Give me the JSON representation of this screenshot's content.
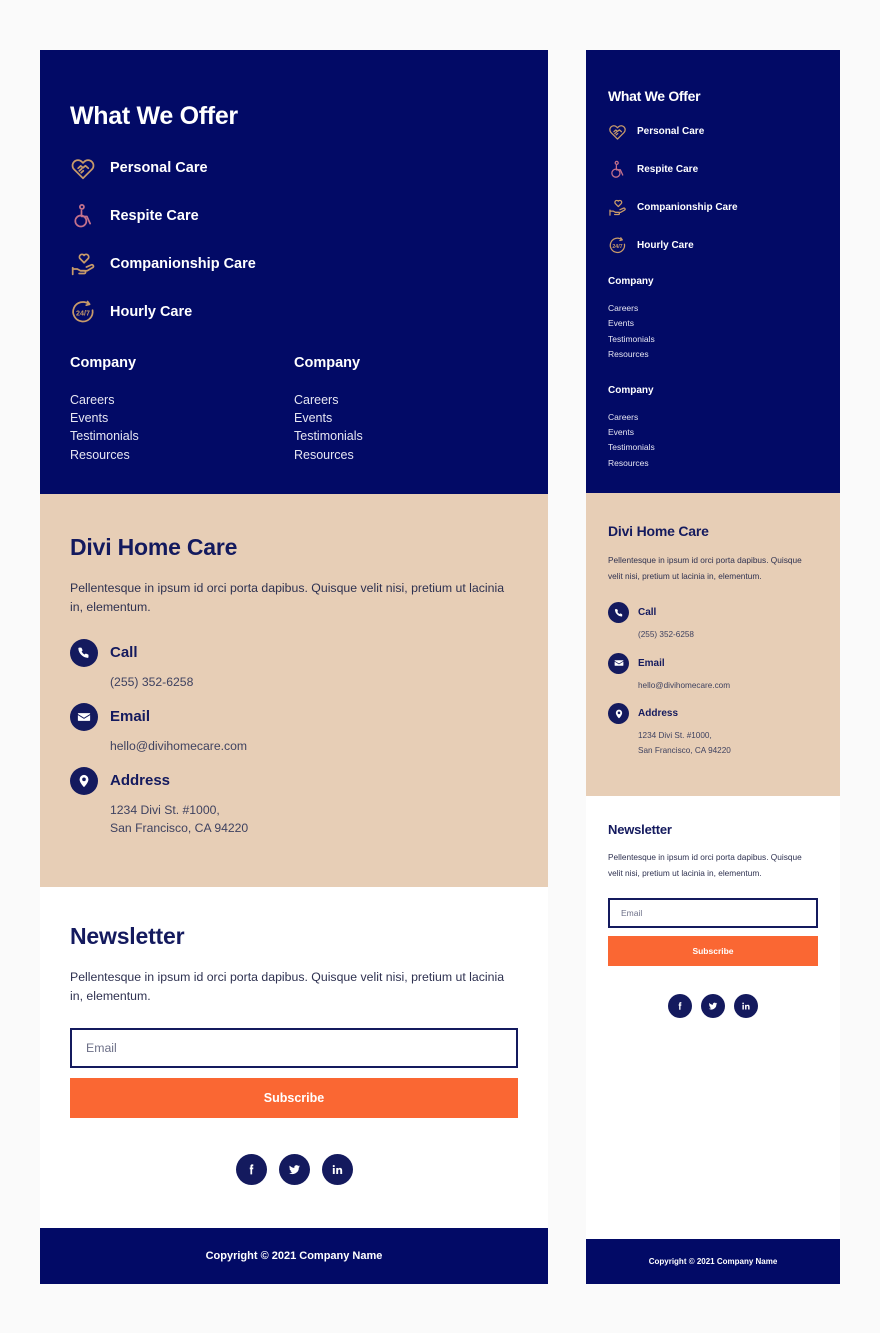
{
  "theme": {
    "navy": "#020a66",
    "navy_deep": "#141a5e",
    "beige": "#e7ceb6",
    "orange": "#fa6733",
    "white": "#ffffff",
    "page_bg": "#fafafa"
  },
  "offers": {
    "title": "What We Offer",
    "services": [
      {
        "label": "Personal Care",
        "icon": "heart-handshake-icon",
        "color": "#c79a6a"
      },
      {
        "label": "Respite Care",
        "icon": "wheelchair-icon",
        "color": "#c4718c"
      },
      {
        "label": "Companionship Care",
        "icon": "hand-heart-icon",
        "color": "#c79a6a"
      },
      {
        "label": "Hourly Care",
        "icon": "twenty-four-seven-icon",
        "color": "#c79a6a"
      }
    ]
  },
  "company_columns": [
    {
      "title": "Company",
      "links": [
        "Careers",
        "Events",
        "Testimonials",
        "Resources"
      ]
    },
    {
      "title": "Company",
      "links": [
        "Careers",
        "Events",
        "Testimonials",
        "Resources"
      ]
    }
  ],
  "contact": {
    "title": "Divi Home Care",
    "description": "Pellentesque in ipsum id orci porta dapibus. Quisque velit nisi, pretium ut lacinia in, elementum.",
    "items": [
      {
        "icon": "phone-icon",
        "label": "Call",
        "value": "(255) 352-6258"
      },
      {
        "icon": "envelope-icon",
        "label": "Email",
        "value": "hello@divihomecare.com"
      },
      {
        "icon": "map-pin-icon",
        "label": "Address",
        "value": "1234 Divi St. #1000,\nSan Francisco, CA 94220"
      }
    ]
  },
  "newsletter": {
    "title": "Newsletter",
    "description": "Pellentesque in ipsum id orci porta dapibus. Quisque velit nisi, pretium ut lacinia in, elementum.",
    "email_placeholder": "Email",
    "email_value": "",
    "subscribe_label": "Subscribe",
    "socials": [
      {
        "icon": "facebook-icon",
        "name": "Facebook"
      },
      {
        "icon": "twitter-icon",
        "name": "Twitter"
      },
      {
        "icon": "linkedin-icon",
        "name": "LinkedIn"
      }
    ]
  },
  "copyright": "Copyright © 2021 Company Name"
}
